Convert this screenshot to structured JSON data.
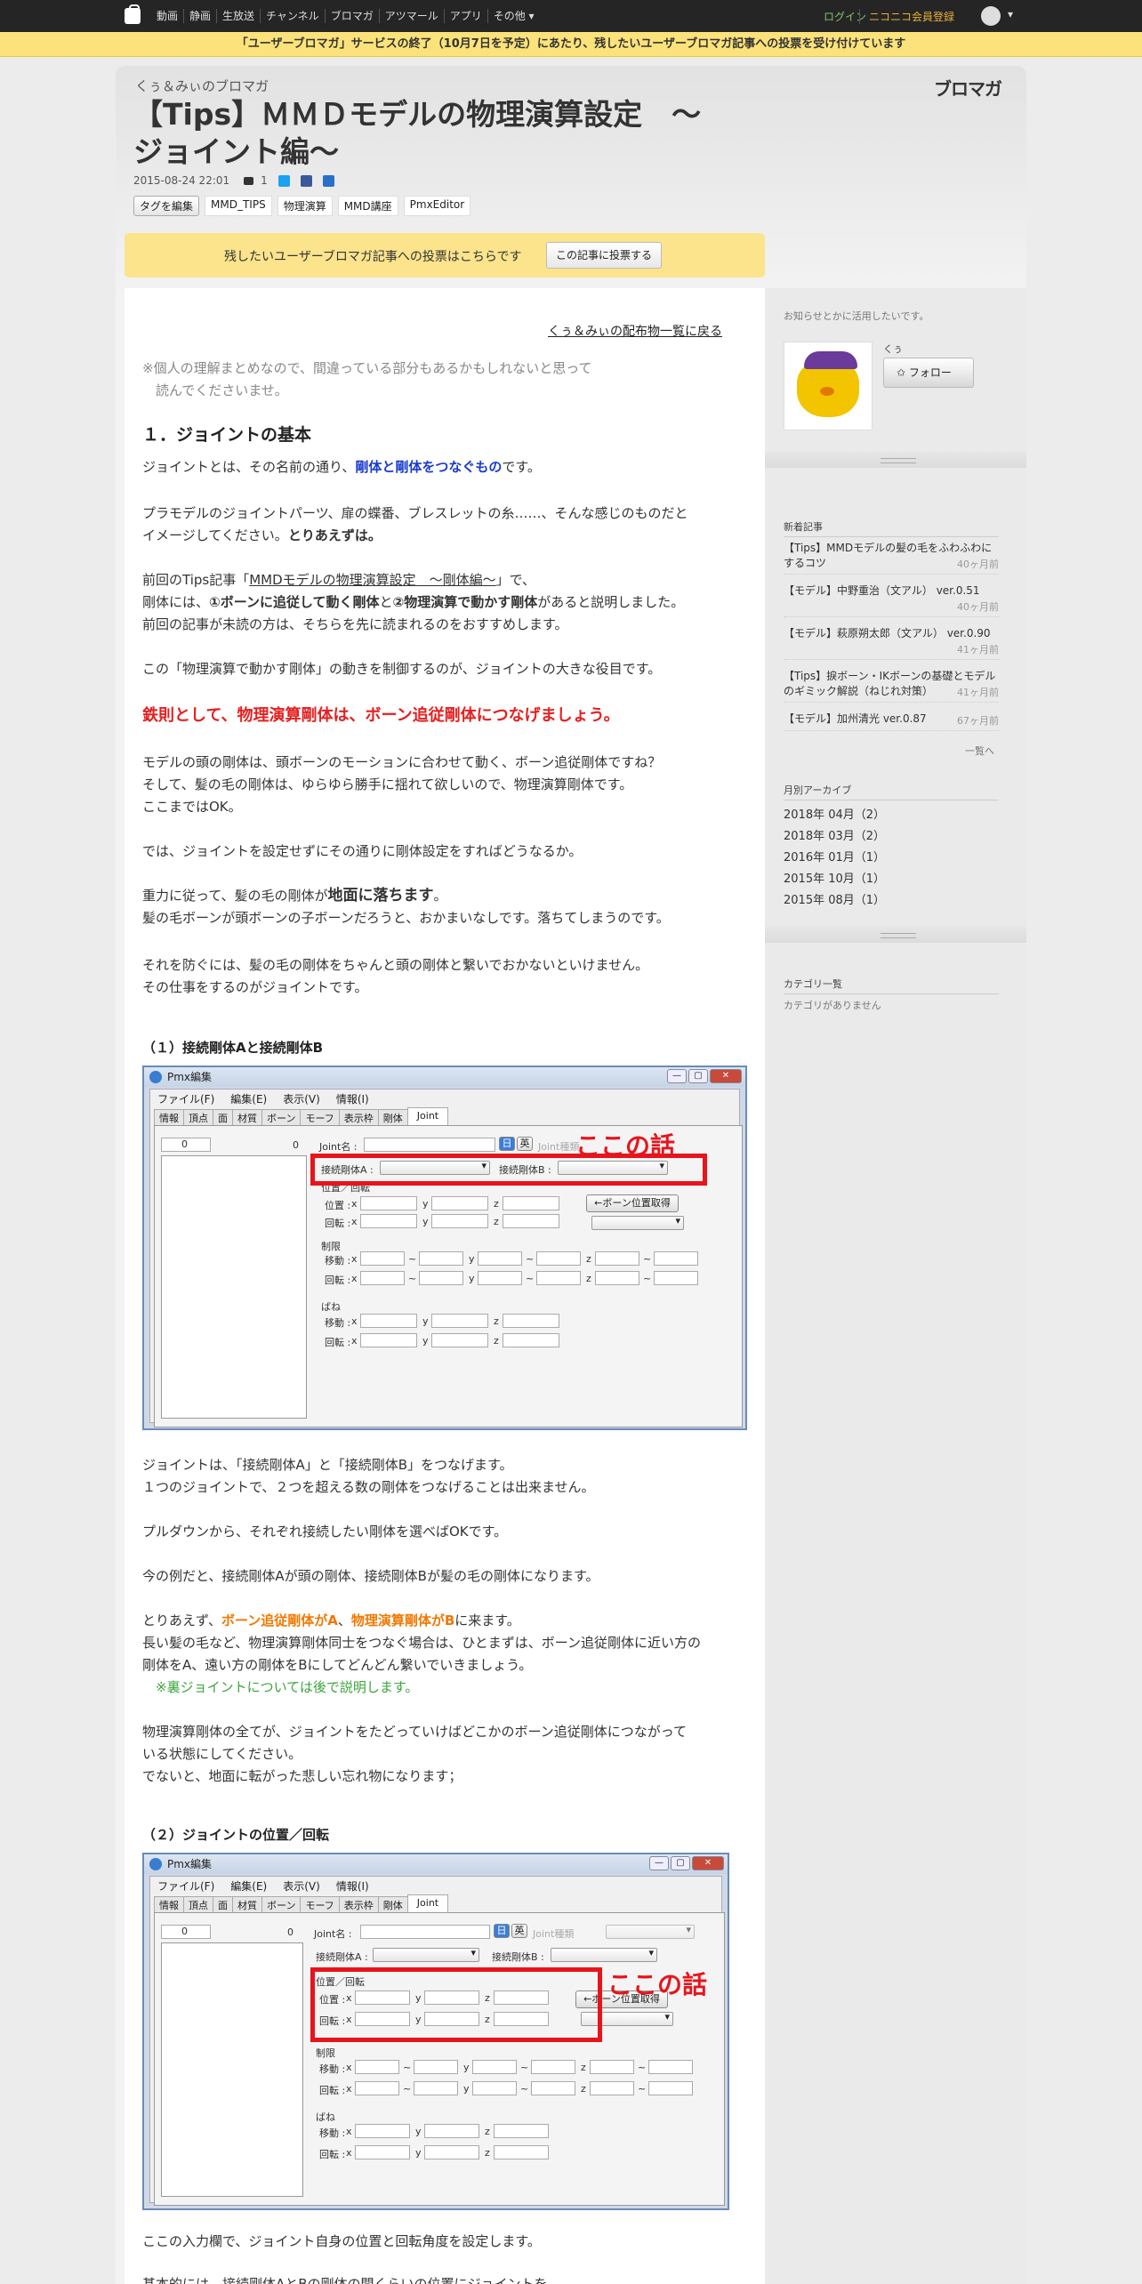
{
  "topnav": {
    "links": [
      "動画",
      "静画",
      "生放送",
      "チャンネル",
      "ブロマガ",
      "アツマール",
      "アプリ",
      "その他 ▾"
    ],
    "login": "ログイン",
    "register": "ニコニコ会員登録",
    "avatar_chevron": "▾"
  },
  "announcement": "「ユーザーブロマガ」サービスの終了（10月7日を予定）にあたり、残したいユーザーブロマガ記事への投票を受け付けています",
  "header": {
    "blog_name": "くぅ＆みぃのブロマガ",
    "brand": "ブロマガ",
    "title_line1": "【Tips】ＭＭＤモデルの物理演算設定　～",
    "title_line2": "ジョイント編～",
    "date": "2015-08-24 22:01",
    "comment_count": "1",
    "tag_edit": "タグを編集",
    "tags": [
      "MMD_TIPS",
      "物理演算",
      "MMD講座",
      "PmxEditor"
    ]
  },
  "vote": {
    "message": "残したいユーザーブロマガ記事への投票はこちらです",
    "button": "この記事に投票する"
  },
  "article": {
    "back_link": "くぅ＆みぃの配布物一覧に戻る",
    "note_1": "※個人の理解まとめなので、間違っている部分もあるかもしれないと思って",
    "note_2": "　読んでくださいませ。",
    "heading_1": "１．ジョイントの基本",
    "p1_a": "ジョイントとは、その名前の通り、",
    "p1_b": "剛体と剛体をつなぐもの",
    "p1_c": "です。",
    "p2_1": "プラモデルのジョイントパーツ、扉の蝶番、ブレスレットの糸……、そんな感じのものだと",
    "p2_2a": "イメージしてください。",
    "p2_2b": "とりあえずは。",
    "p3_1a": "前回のTips記事「",
    "p3_1b": "MMDモデルの物理演算設定　～剛体編～",
    "p3_1c": "」で、",
    "p3_2a": "剛体には、",
    "p3_2b": "①ボーンに追従して動く剛体",
    "p3_2c": "と",
    "p3_2d": "②物理演算で動かす剛体",
    "p3_2e": "があると説明しました。",
    "p3_3": "前回の記事が未読の方は、そちらを先に読まれるのをおすすめします。",
    "p4": "この「物理演算で動かす剛体」の動きを制御するのが、ジョイントの大きな役目です。",
    "rule": "鉄則として、物理演算剛体は、ボーン追従剛体につなげましょう。",
    "p5_1": "モデルの頭の剛体は、頭ボーンのモーションに合わせて動く、ボーン追従剛体ですね？",
    "p5_2": "そして、髪の毛の剛体は、ゆらゆら勝手に揺れて欲しいので、物理演算剛体です。",
    "p5_3": "ここまではOK。",
    "p6": "では、ジョイントを設定せずにその通りに剛体設定をすればどうなるか。",
    "p7_1a": "重力に従って、髪の毛の剛体が",
    "p7_1b": "地面に落ちます",
    "p7_1c": "。",
    "p7_2": "髪の毛ボーンが頭ボーンの子ボーンだろうと、おかまいなしです。落ちてしまうのです。",
    "p8_1": "それを防ぐには、髪の毛の剛体をちゃんと頭の剛体と繋いでおかないといけません。",
    "p8_2": "その仕事をするのがジョイントです。",
    "heading_2": "（１）接続剛体Aと接続剛体B",
    "p9_1": "ジョイントは、「接続剛体A」と「接続剛体B」をつなげます。",
    "p9_2": "１つのジョイントで、２つを超える数の剛体をつなげることは出来ません。",
    "p10": "プルダウンから、それぞれ接続したい剛体を選べばOKです。",
    "p11": "今の例だと、接続剛体Aが頭の剛体、接続剛体Bが髪の毛の剛体になります。",
    "p12_1a": "とりあえず、",
    "p12_1b": "ボーン追従剛体がA",
    "p12_1c": "、",
    "p12_1d": "物理演算剛体がB",
    "p12_1e": "に来ます。",
    "p12_2": "長い髪の毛など、物理演算剛体同士をつなぐ場合は、ひとまずは、ボーン追従剛体に近い方の",
    "p12_3": "剛体をA、遠い方の剛体をBにしてどんどん繋いでいきましょう。",
    "p12_4": "　※裏ジョイントについては後で説明します。",
    "p13_1": "物理演算剛体の全てが、ジョイントをたどっていけばどこかのボーン追従剛体につながって",
    "p13_2": "いる状態にしてください。",
    "p13_3": "でないと、地面に転がった悲しい忘れ物になります；",
    "heading_3": "（２）ジョイントの位置／回転",
    "p14": "ここの入力欄で、ジョイント自身の位置と回転角度を設定します。",
    "p15": "基本的には、接続剛体AとBの剛体の間くらいの位置にジョイントを"
  },
  "pmx": {
    "window_title": "Pmx編集",
    "window_buttons": [
      "—",
      "▢",
      "✕"
    ],
    "menu": [
      "ファイル(F)",
      "編集(E)",
      "表示(V)",
      "情報(I)"
    ],
    "tabs": [
      "情報",
      "頂点",
      "面",
      "材質",
      "ボーン",
      "モーフ",
      "表示枠",
      "剛体",
      "Joint"
    ],
    "list_index": "0",
    "list_count": "0",
    "joint_name": "Joint名 :",
    "btn_day": "日",
    "btn_eng": "英",
    "joint_type": "Joint種類",
    "body_a": "接続剛体A :",
    "body_b": "接続剛体B :",
    "pos_rot": "位置／回転",
    "pos": "位置 :",
    "rot": "回転 :",
    "x": "x",
    "y": "y",
    "z": "z",
    "limit": "制限",
    "move": "移動 :",
    "rotate": "回転 :",
    "tilde": "~",
    "spring": "ばね",
    "bone_pos_btn": "←ボーン位置取得",
    "callout": "ここの話"
  },
  "sidebar": {
    "info": "お知らせとかに活用したいです。",
    "username": "くぅ",
    "follow": "✩ フォロー",
    "new_articles_heading": "新着記事",
    "new_articles": [
      {
        "title": "【Tips】MMDモデルの髪の毛をふわふわにするコツ",
        "ago": "40ヶ月前"
      },
      {
        "title": "【モデル】中野重治（文アル） ver.0.51",
        "ago": "40ヶ月前"
      },
      {
        "title": "【モデル】萩原朔太郎（文アル） ver.0.90",
        "ago": "41ヶ月前"
      },
      {
        "title": "【Tips】捩ボーン・IKボーンの基礎とモデルのギミック解説（ねじれ対策）",
        "ago": "41ヶ月前"
      },
      {
        "title": "【モデル】加州清光 ver.0.87",
        "ago": "67ヶ月前"
      }
    ],
    "more": "一覧へ",
    "archive_heading": "月別アーカイブ",
    "archives": [
      "2018年 04月（2）",
      "2018年 03月（2）",
      "2016年 01月（1）",
      "2015年 10月（1）",
      "2015年 08月（1）"
    ],
    "category_heading": "カテゴリ一覧",
    "category_none": "カテゴリがありません"
  },
  "colors": {
    "accent_blue": "#1a3ccc",
    "alert_red": "#e52020",
    "orange": "#f07800",
    "green": "#3aa53a",
    "announce_bg": "#fbe27a"
  }
}
